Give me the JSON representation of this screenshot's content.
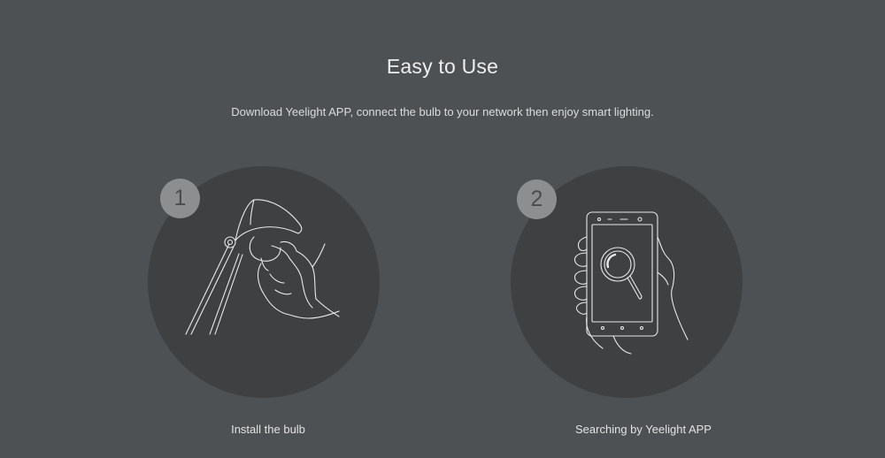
{
  "heading": {
    "title": "Easy to Use",
    "subtitle": "Download Yeelight APP, connect the bulb to your network then enjoy smart lighting."
  },
  "steps": [
    {
      "number": "1",
      "icon": "lamp-install-hand-icon",
      "caption": "Install the bulb"
    },
    {
      "number": "2",
      "icon": "phone-search-hand-icon",
      "caption": "Searching by Yeelight APP"
    }
  ],
  "colors": {
    "background": "#4e5153",
    "circle": "#3e4042",
    "badge": "#8c8e90",
    "line_art": "#e8e8e8",
    "text": "#e6e7e8"
  }
}
